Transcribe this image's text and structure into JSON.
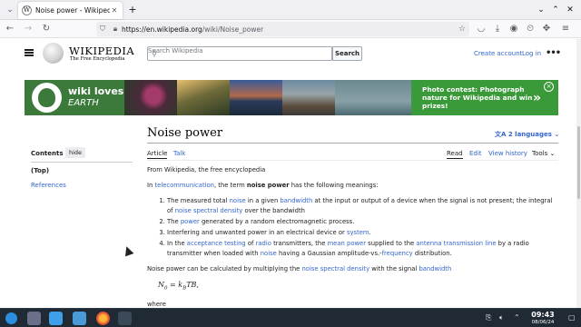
{
  "browser": {
    "tab_title": "Noise power - Wikipedia",
    "tab_favicon": "W",
    "url_host": "https://en.wikipedia.org",
    "url_path": "/wiki/Noise_power"
  },
  "wiki": {
    "wordmark": "WIKIPEDIA",
    "tagline": "The Free Encyclopedia",
    "search_placeholder": "Search Wikipedia",
    "search_button": "Search",
    "create_account": "Create account",
    "log_in": "Log in",
    "more": "•••"
  },
  "banner": {
    "brand_line1": "wiki loves",
    "brand_line2": "EARTH",
    "cta_text": "Photo contest: Photograph nature for Wikipedia and win prizes!",
    "cta_arrow": "»",
    "close": "×",
    "colors": {
      "brand_bg": "#3c7a3c",
      "cta_bg": "#3a9a3a"
    }
  },
  "toc": {
    "title": "Contents",
    "hide": "hide",
    "items": [
      "(Top)",
      "References"
    ]
  },
  "article": {
    "title": "Noise power",
    "languages": "2 languages",
    "tabs": {
      "article": "Article",
      "talk": "Talk",
      "read": "Read",
      "edit": "Edit",
      "history": "View history",
      "tools": "Tools"
    },
    "from": "From Wikipedia, the free encyclopedia",
    "intro": {
      "a": "In ",
      "link1": "telecommunication",
      "b": ", the term ",
      "term": "noise power",
      "c": " has the following meanings:"
    },
    "items": [
      {
        "a": "The measured total ",
        "l1": "noise",
        "b": " in a given ",
        "l2": "bandwidth",
        "c": " at the input or output of a device when the signal is not present; the integral of ",
        "l3": "noise spectral density",
        "d": " over the bandwidth"
      },
      {
        "a": "The ",
        "l1": "power",
        "b": " generated by a random electromagnetic process."
      },
      {
        "a": "Interfering and unwanted power in an electrical device or ",
        "l1": "system",
        "b": "."
      },
      {
        "a": "In the ",
        "l1": "acceptance testing",
        "b": " of ",
        "l2": "radio",
        "c": " transmitters, the ",
        "l3": "mean power",
        "d": " supplied to the ",
        "l4": "antenna transmission line",
        "e": " by a radio transmitter when loaded with ",
        "l5": "noise",
        "f": " having a Gaussian amplitude-vs.-",
        "l6": "frequency",
        "g": " distribution."
      }
    ],
    "calc": {
      "a": "Noise power can be calculated by multiplying the ",
      "l1": "noise spectral density",
      "b": " with the signal ",
      "l2": "bandwidth"
    },
    "formula_lhs": "N",
    "formula_lhs_sub": "0",
    "formula_rhs": "= k",
    "formula_rhs_sub": "B",
    "formula_tail": "TB,",
    "where": "where"
  },
  "taskbar": {
    "time": "09:43",
    "date": "08/06/24"
  }
}
